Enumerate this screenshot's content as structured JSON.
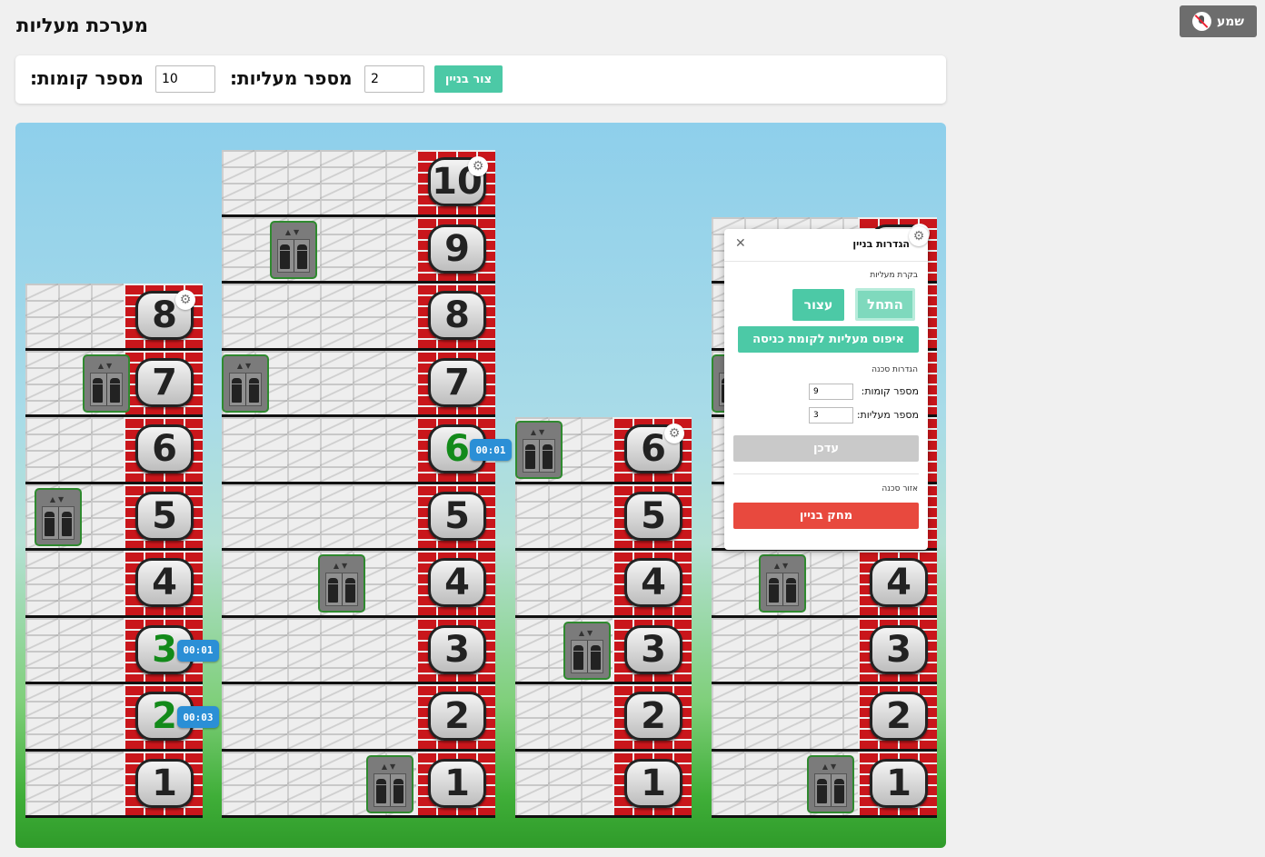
{
  "app": {
    "title": "מערכת מעליות",
    "mute_label": "שמע",
    "icons": {
      "mute": "mic-off-icon",
      "gear": "gear-icon",
      "close": "close-icon",
      "elevator": "elevator-icon"
    }
  },
  "controls": {
    "floors_label": "מספר קומות:",
    "floors_value": "10",
    "elevators_label": "מספר מעליות:",
    "elevators_value": "2",
    "build_label": "צור בניין"
  },
  "buildings": [
    {
      "floors": 8,
      "called": [
        {
          "floor": 3,
          "timer": "00:01"
        },
        {
          "floor": 2,
          "timer": "00:03"
        }
      ],
      "elevator_floors": [
        7,
        5
      ]
    },
    {
      "floors": 10,
      "called": [
        {
          "floor": 6,
          "timer": "00:01"
        }
      ],
      "elevator_floors": [
        9,
        7,
        4,
        1
      ]
    },
    {
      "floors": 6,
      "called": [],
      "elevator_floors": [
        6,
        3
      ]
    },
    {
      "floors": 9,
      "called": [],
      "elevator_floors": [
        7,
        4,
        1
      ]
    }
  ],
  "settings_panel": {
    "title": "הגדרות בניין",
    "control_section": "בקרת מעליות",
    "start_label": "התחל",
    "stop_label": "עצור",
    "reset_label": "איפוס מעליות לקומת כניסה",
    "scene_settings": "הגדרות סכנה",
    "floors_label": "מספר קומות:",
    "floors_value": "9",
    "elevators_label": "מספר מעליות:",
    "elevators_value": "3",
    "update_label": "עדכן",
    "danger_zone": "אזור סכנה",
    "delete_label": "מחק בניין"
  },
  "colors": {
    "accent": "#4cc9a6",
    "danger": "#e8493e",
    "timer": "#2b8fd6",
    "brick": "#c9161b",
    "called_number": "#138a1a"
  }
}
